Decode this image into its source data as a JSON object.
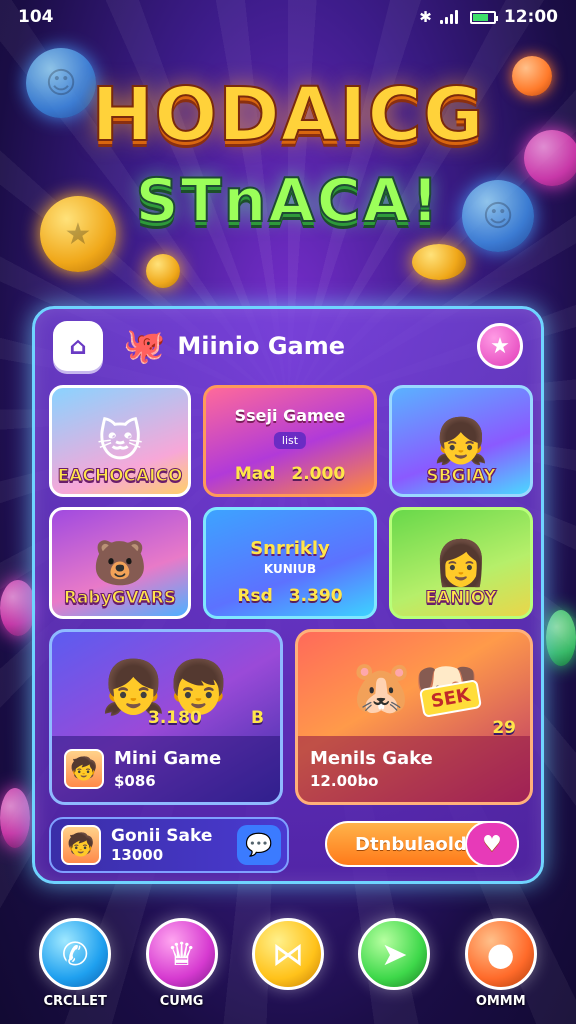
{
  "status_bar": {
    "left": "104",
    "time": "12:00"
  },
  "title": {
    "line1": "HODAICG",
    "line2": "STnACA!"
  },
  "panel": {
    "title": "Miinio Game",
    "cards": [
      {
        "label": "EACHOCAICO"
      },
      {
        "title": "Sseji Gamee",
        "pill": "list",
        "left": "Mad",
        "price": "2.000"
      },
      {
        "label": "SBGIAY"
      },
      {
        "label": "RabyGVARS"
      },
      {
        "title": "Snrrikly",
        "sub": "KUNIUB",
        "left": "Rsd",
        "price": "3.390"
      },
      {
        "label": "EANIOY"
      }
    ],
    "big_cards": [
      {
        "title": "Mini Game",
        "price": "$086",
        "badge": "3.180",
        "badge2": "B"
      },
      {
        "title": "Menils Gake",
        "price": "12.00bo",
        "tag": "SEK",
        "badge": "29"
      }
    ],
    "bottom_game": {
      "title": "Gonii Sake",
      "price": "13000"
    },
    "download_label": "Dtnbulaold"
  },
  "nav": [
    {
      "label": "CRCLLET"
    },
    {
      "label": "CUMG"
    },
    {
      "label": ""
    },
    {
      "label": ""
    },
    {
      "label": "OMMM"
    }
  ]
}
